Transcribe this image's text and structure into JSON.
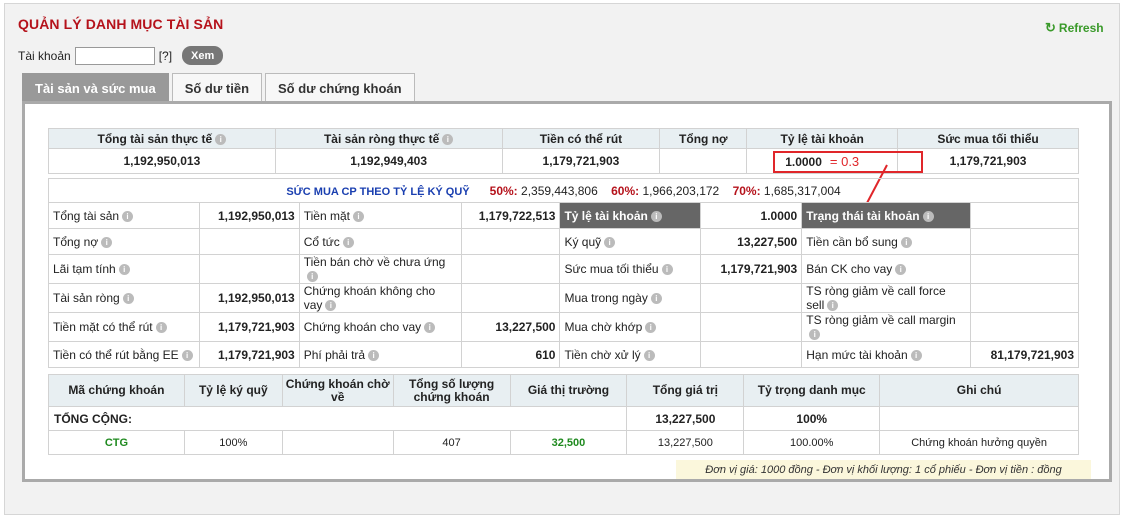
{
  "header": {
    "title": "QUẢN LÝ DANH MỤC TÀI SẢN",
    "refresh_label": "Refresh",
    "account_label": "Tài khoản",
    "account_value": "",
    "help_label": "[?]",
    "view_button": "Xem"
  },
  "tabs": [
    {
      "label": "Tài sản và sức mua",
      "active": true
    },
    {
      "label": "Số dư tiền",
      "active": false
    },
    {
      "label": "Số dư chứng khoán",
      "active": false
    }
  ],
  "summary": {
    "headers": [
      "Tổng tài sản thực tế",
      "Tài sản ròng thực tế",
      "Tiền có thể rút",
      "Tổng nợ",
      "Tỷ lệ tài khoản",
      "Sức mua tối thiểu"
    ],
    "values": [
      "1,192,950,013",
      "1,192,949,403",
      "1,179,721,903",
      "",
      "1.0000",
      "1,179,721,903"
    ],
    "annotation": "= 0.3"
  },
  "margin": {
    "title": "SỨC MUA CP THEO TỶ LỆ KÝ QUỸ",
    "p50_label": "50%:",
    "p50_value": "2,359,443,806",
    "p60_label": "60%:",
    "p60_value": "1,966,203,172",
    "p70_label": "70%:",
    "p70_value": "1,685,317,004"
  },
  "details": {
    "rows": [
      [
        "Tổng tài sản",
        "1,192,950,013",
        "Tiền mặt",
        "1,179,722,513",
        "Tỷ lệ tài khoản",
        "1.0000",
        "Trạng thái tài khoản",
        ""
      ],
      [
        "Tổng nợ",
        "",
        "Cổ tức",
        "",
        "Ký quỹ",
        "13,227,500",
        "Tiền cần bổ sung",
        ""
      ],
      [
        "Lãi tạm tính",
        "",
        "Tiền bán chờ về chưa ứng",
        "",
        "Sức mua tối thiểu",
        "1,179,721,903",
        "Bán CK cho vay",
        ""
      ],
      [
        "Tài sản ròng",
        "1,192,950,013",
        "Chứng khoán không cho vay",
        "",
        "Mua trong ngày",
        "",
        "TS ròng giảm về call force sell",
        ""
      ],
      [
        "Tiền mặt có thể rút",
        "1,179,721,903",
        "Chứng khoán cho vay",
        "13,227,500",
        "Mua chờ khớp",
        "",
        "TS ròng giảm về call margin",
        ""
      ],
      [
        "Tiền có thể rút bằng EE",
        "1,179,721,903",
        "Phí phải trả",
        "610",
        "Tiền chờ xử lý",
        "",
        "Hạn mức tài khoản",
        "81,179,721,903"
      ]
    ]
  },
  "portfolio": {
    "headers": [
      "Mã chứng khoán",
      "Tỷ lệ ký quỹ",
      "Chứng khoán chờ về",
      "Tổng số lượng chứng khoán",
      "Giá thị trường",
      "Tổng giá trị",
      "Tỷ trọng danh mục",
      "Ghi chú"
    ],
    "total_label": "TỔNG CỘNG:",
    "total_value": "13,227,500",
    "total_weight": "100%",
    "rows": [
      [
        "CTG",
        "100%",
        "",
        "407",
        "32,500",
        "13,227,500",
        "100.00%",
        "Chứng khoán hưởng quyền"
      ]
    ],
    "note": "Đơn vị giá: 1000 đồng - Đơn vị khối lượng: 1 cổ phiếu - Đơn vị tiền : đồng"
  }
}
